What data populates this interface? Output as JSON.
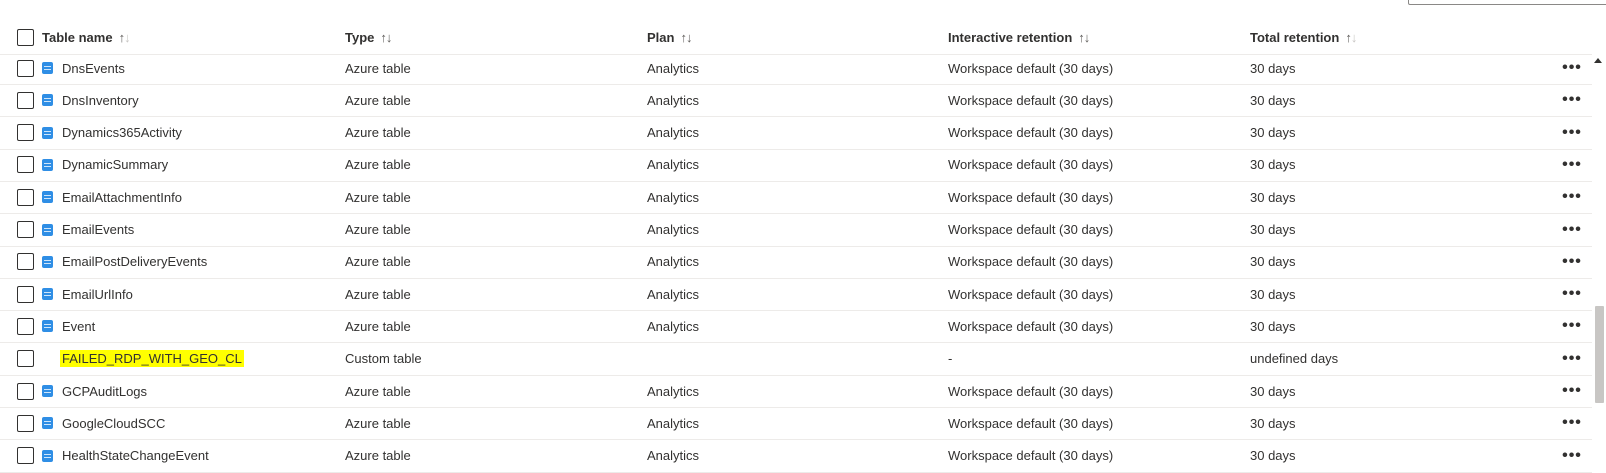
{
  "columns": {
    "name": "Table name",
    "type": "Type",
    "plan": "Plan",
    "interactive_retention": "Interactive retention",
    "total_retention": "Total retention"
  },
  "more_actions_label": "•••",
  "rows": [
    {
      "name": "DnsEvents",
      "type": "Azure table",
      "plan": "Analytics",
      "interactive_retention": "Workspace default (30 days)",
      "total_retention": "30 days"
    },
    {
      "name": "DnsInventory",
      "type": "Azure table",
      "plan": "Analytics",
      "interactive_retention": "Workspace default (30 days)",
      "total_retention": "30 days"
    },
    {
      "name": "Dynamics365Activity",
      "type": "Azure table",
      "plan": "Analytics",
      "interactive_retention": "Workspace default (30 days)",
      "total_retention": "30 days"
    },
    {
      "name": "DynamicSummary",
      "type": "Azure table",
      "plan": "Analytics",
      "interactive_retention": "Workspace default (30 days)",
      "total_retention": "30 days"
    },
    {
      "name": "EmailAttachmentInfo",
      "type": "Azure table",
      "plan": "Analytics",
      "interactive_retention": "Workspace default (30 days)",
      "total_retention": "30 days"
    },
    {
      "name": "EmailEvents",
      "type": "Azure table",
      "plan": "Analytics",
      "interactive_retention": "Workspace default (30 days)",
      "total_retention": "30 days"
    },
    {
      "name": "EmailPostDeliveryEvents",
      "type": "Azure table",
      "plan": "Analytics",
      "interactive_retention": "Workspace default (30 days)",
      "total_retention": "30 days"
    },
    {
      "name": "EmailUrlInfo",
      "type": "Azure table",
      "plan": "Analytics",
      "interactive_retention": "Workspace default (30 days)",
      "total_retention": "30 days"
    },
    {
      "name": "Event",
      "type": "Azure table",
      "plan": "Analytics",
      "interactive_retention": "Workspace default (30 days)",
      "total_retention": "30 days"
    },
    {
      "name": "FAILED_RDP_WITH_GEO_CL",
      "type": "Custom table",
      "plan": "",
      "interactive_retention": "-",
      "total_retention": "undefined days"
    },
    {
      "name": "GCPAuditLogs",
      "type": "Azure table",
      "plan": "Analytics",
      "interactive_retention": "Workspace default (30 days)",
      "total_retention": "30 days"
    },
    {
      "name": "GoogleCloudSCC",
      "type": "Azure table",
      "plan": "Analytics",
      "interactive_retention": "Workspace default (30 days)",
      "total_retention": "30 days"
    },
    {
      "name": "HealthStateChangeEvent",
      "type": "Azure table",
      "plan": "Analytics",
      "interactive_retention": "Workspace default (30 days)",
      "total_retention": "30 days"
    }
  ],
  "colors": {
    "highlight": "#ffff00",
    "table_icon": "#2f8ee5",
    "row_divider": "#edebe9"
  }
}
